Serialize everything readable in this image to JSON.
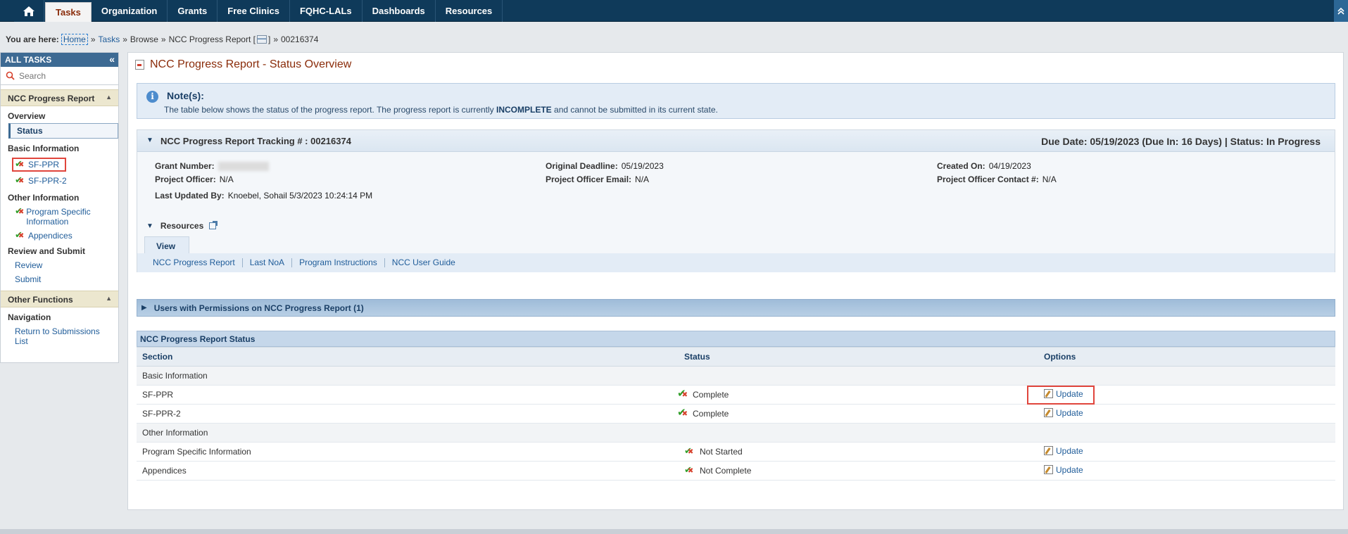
{
  "nav": {
    "tabs": [
      "Tasks",
      "Organization",
      "Grants",
      "Free Clinics",
      "FQHC-LALs",
      "Dashboards",
      "Resources"
    ],
    "active_tab": "Tasks"
  },
  "breadcrumb": {
    "label": "You are here:",
    "home": "Home",
    "tasks": "Tasks",
    "browse": "Browse",
    "report": "NCC Progress Report [",
    "report_end": "]",
    "id": "00216374"
  },
  "sidebar": {
    "header": "ALL TASKS",
    "search_placeholder": "Search",
    "group1": "NCC Progress Report",
    "cat_overview": "Overview",
    "item_status": "Status",
    "cat_basic": "Basic Information",
    "item_sfppr": "SF-PPR",
    "item_sfppr2": "SF-PPR-2",
    "cat_other": "Other Information",
    "item_psi": "Program Specific Information",
    "item_appendices": "Appendices",
    "cat_review": "Review and Submit",
    "item_review": "Review",
    "item_submit": "Submit",
    "group2": "Other Functions",
    "cat_nav": "Navigation",
    "item_return": "Return to Submissions List"
  },
  "main": {
    "title": "NCC Progress Report - Status Overview",
    "note_title": "Note(s):",
    "note_pre": "The table below shows the status of the progress report. The progress report is currently ",
    "note_bold": "INCOMPLETE",
    "note_post": " and cannot be submitted in its current state.",
    "tracking_title": "NCC Progress Report Tracking # : 00216374",
    "due_label": "Due Date: 05/19/2023 ",
    "due_in": "(Due In: 16 Days)",
    "status_label": " | Status: In Progress",
    "fields": {
      "grant_number_k": "Grant Number:",
      "project_officer_k": "Project Officer:",
      "project_officer_v": "N/A",
      "last_updated_k": "Last Updated By:",
      "last_updated_v": "Knoebel, Sohail 5/3/2023 10:24:14 PM",
      "orig_deadline_k": "Original Deadline:",
      "orig_deadline_v": "05/19/2023",
      "po_email_k": "Project Officer Email:",
      "po_email_v": "N/A",
      "created_k": "Created On:",
      "created_v": "04/19/2023",
      "po_contact_k": "Project Officer Contact #:",
      "po_contact_v": "N/A"
    },
    "resources_title": "Resources",
    "resources_tab": "View",
    "resources_links": [
      "NCC Progress Report",
      "Last NoA",
      "Program Instructions",
      "NCC User Guide"
    ],
    "permissions_title": "Users with Permissions on NCC Progress Report (1)",
    "status_title": "NCC Progress Report Status",
    "table": {
      "headers": [
        "Section",
        "Status",
        "Options"
      ],
      "cat_basic": "Basic Information",
      "cat_other": "Other Information",
      "rows": [
        {
          "section": "SF-PPR",
          "status": "Complete",
          "option": "Update"
        },
        {
          "section": "SF-PPR-2",
          "status": "Complete",
          "option": "Update"
        },
        {
          "section": "Program Specific Information",
          "status": "Not Started",
          "option": "Update"
        },
        {
          "section": "Appendices",
          "status": "Not Complete",
          "option": "Update"
        }
      ]
    }
  },
  "colors": {
    "nav_bg": "#0f3a5a",
    "title_color": "#8a2c0a",
    "link": "#1f5c99",
    "highlight": "#e0453c"
  }
}
